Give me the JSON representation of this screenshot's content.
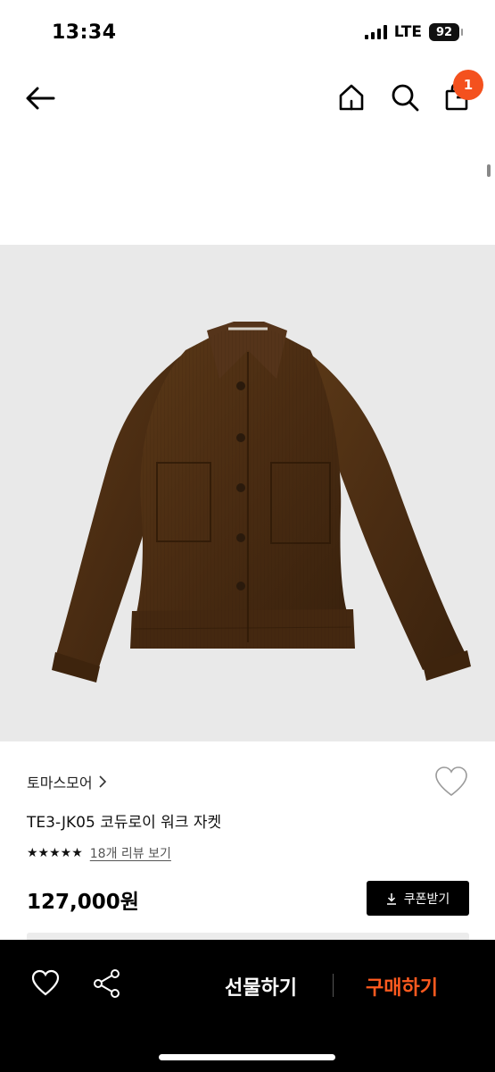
{
  "status": {
    "time": "13:34",
    "network": "LTE",
    "battery": "92"
  },
  "header": {
    "cart_count": "1"
  },
  "product": {
    "brand": "토마스모어",
    "name": "TE3-JK05 코듀로이 워크 자켓",
    "stars": "★★★★★",
    "rating_stars": 5,
    "review_link": "18개 리뷰 보기",
    "price": "127,000원",
    "coupon_label": "쿠폰받기"
  },
  "bottom": {
    "gift_label": "선물하기",
    "buy_label": "구매하기"
  },
  "colors": {
    "accent": "#ff5a1f",
    "badge": "#f4511e",
    "bar": "#000000",
    "jacket": "#4a2c13"
  }
}
